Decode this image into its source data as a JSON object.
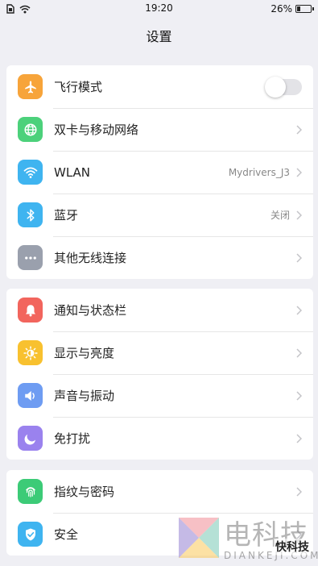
{
  "status_bar": {
    "time": "19:20",
    "battery_percent": "26%",
    "battery_level": 0.26
  },
  "header": {
    "title": "设置"
  },
  "sections": [
    {
      "items": [
        {
          "label": "飞行模式",
          "icon": "airplane-icon",
          "color": "#f7a43a",
          "control": "toggle",
          "toggle_on": false
        },
        {
          "label": "双卡与移动网络",
          "icon": "globe-icon",
          "color": "#4cd17b",
          "control": "chevron"
        },
        {
          "label": "WLAN",
          "icon": "wifi-icon",
          "color": "#3fb4f0",
          "value": "Mydrivers_J3",
          "control": "chevron"
        },
        {
          "label": "蓝牙",
          "icon": "bluetooth-icon",
          "color": "#3fb4f0",
          "value": "关闭",
          "control": "chevron"
        },
        {
          "label": "其他无线连接",
          "icon": "more-icon",
          "color": "#9aa0ad",
          "control": "chevron"
        }
      ]
    },
    {
      "items": [
        {
          "label": "通知与状态栏",
          "icon": "bell-icon",
          "color": "#f2655d",
          "control": "chevron"
        },
        {
          "label": "显示与亮度",
          "icon": "brightness-icon",
          "color": "#f8c12f",
          "control": "chevron"
        },
        {
          "label": "声音与振动",
          "icon": "speaker-icon",
          "color": "#6e9cf2",
          "control": "chevron"
        },
        {
          "label": "免打扰",
          "icon": "moon-icon",
          "color": "#9a82ee",
          "control": "chevron"
        }
      ]
    },
    {
      "items": [
        {
          "label": "指纹与密码",
          "icon": "fingerprint-icon",
          "color": "#3ccb77",
          "control": "chevron"
        },
        {
          "label": "安全",
          "icon": "shield-icon",
          "color": "#3fb4f0",
          "control": "chevron"
        }
      ]
    }
  ],
  "watermark": {
    "text": "电科技",
    "domain": "DIANKEJI.COM",
    "badge": "快科技"
  }
}
